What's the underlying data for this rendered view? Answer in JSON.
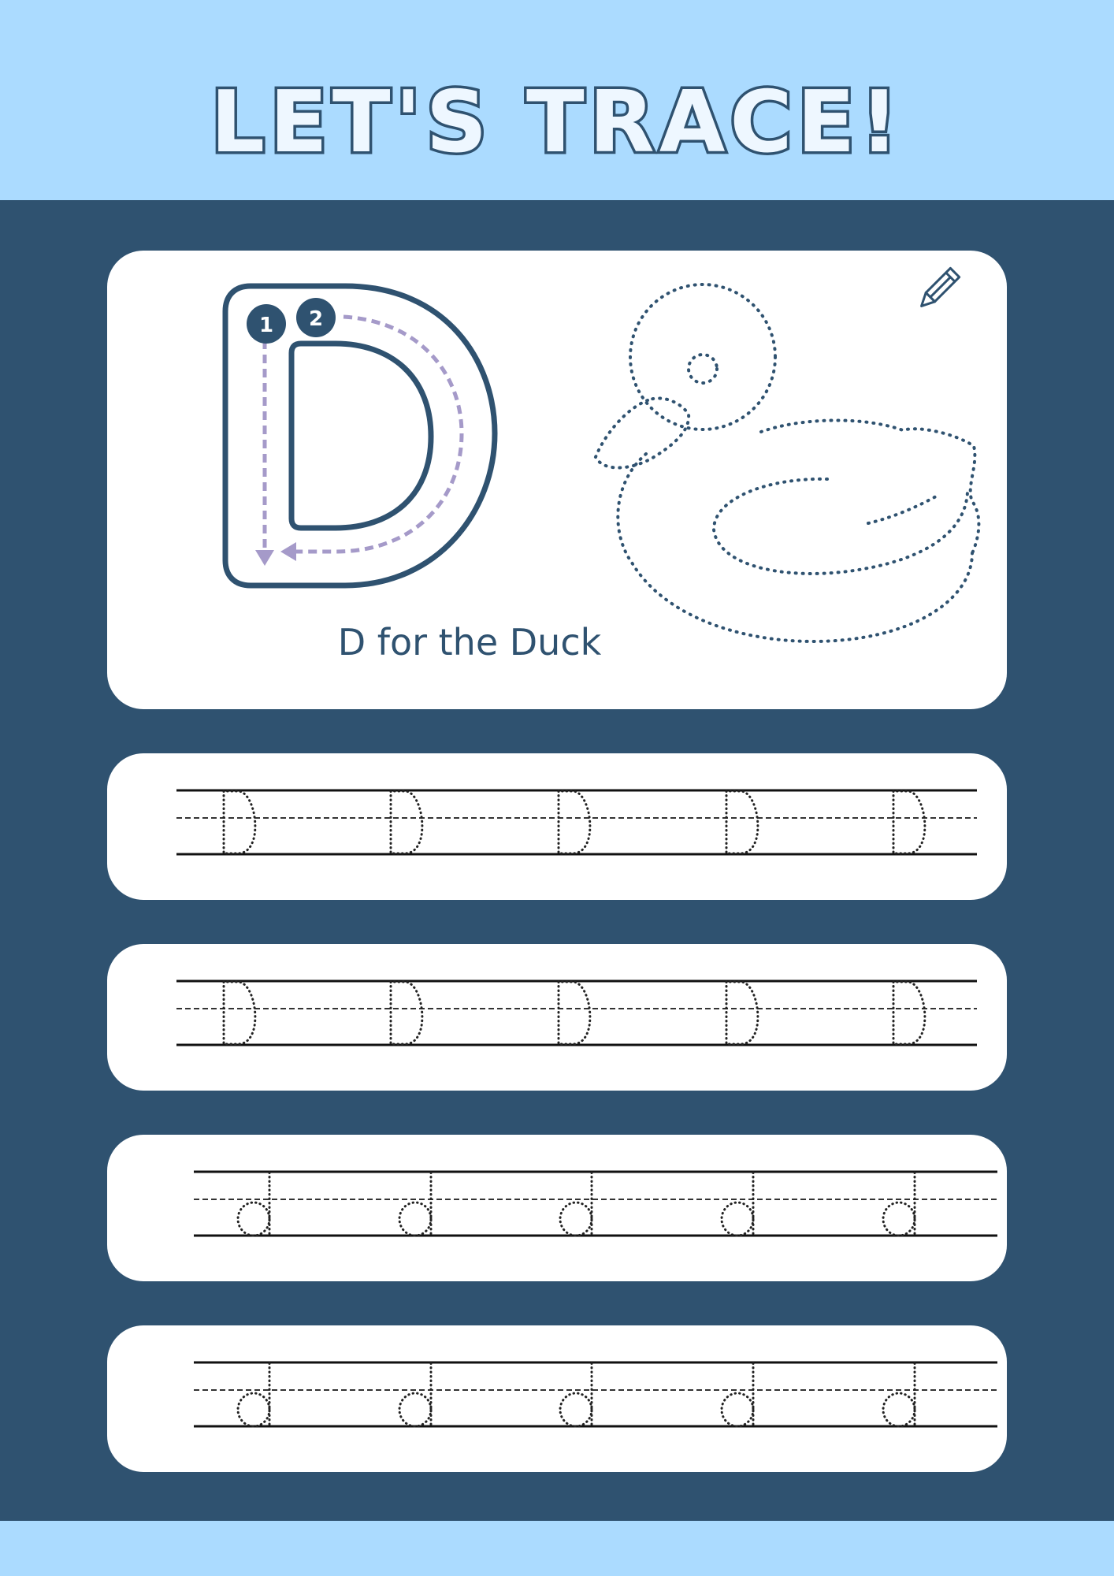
{
  "header": {
    "title": "LET'S TRACE!"
  },
  "letter_card": {
    "letter": "D",
    "stroke_numbers": [
      "1",
      "2"
    ],
    "caption": "D for the Duck",
    "picture": "duck-outline",
    "corner_icon": "pencil-icon"
  },
  "practice_rows": [
    {
      "letter": "D",
      "repeat": 5
    },
    {
      "letter": "D",
      "repeat": 5
    },
    {
      "letter": "d",
      "repeat": 5
    },
    {
      "letter": "d",
      "repeat": 5
    }
  ],
  "colors": {
    "header_band": "#abdbff",
    "background": "#2f5270",
    "card": "#ffffff",
    "guide_arrow": "#a59ac9"
  }
}
